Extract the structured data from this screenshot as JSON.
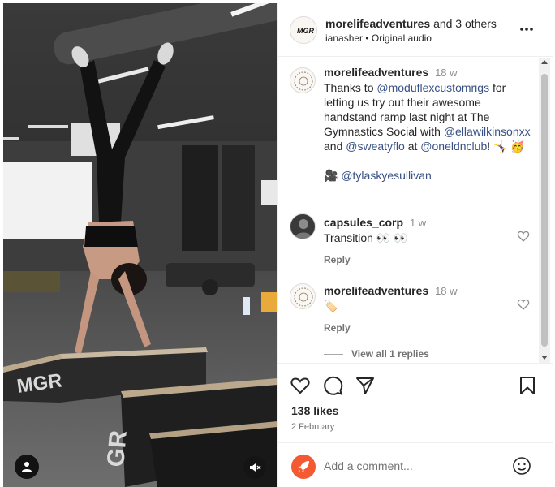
{
  "post": {
    "author": "morelifeadventures",
    "coauthors": "and 3 others",
    "audio_user": "ianasher",
    "audio_label": "Original audio"
  },
  "caption": {
    "user": "morelifeadventures",
    "time": "18 w",
    "text_1": "Thanks to ",
    "mention_1": "@moduflexcustomrigs",
    "text_2": " for letting us try out their awesome handstand ramp last night at The Gymnastics Social with ",
    "mention_2": "@ellawilkinsonxx",
    "text_3": " and ",
    "mention_3": "@sweatyflo",
    "text_4": " at ",
    "mention_4": "@oneldnclub",
    "text_5": "! 🤸‍♀️ 🥳",
    "tag_emoji": "🎥",
    "tag": "@tylaskyesullivan"
  },
  "comments": [
    {
      "user": "capsules_corp",
      "time": "1 w",
      "text": "Transition 👀 👀",
      "reply": "Reply"
    },
    {
      "user": "morelifeadventures",
      "time": "18 w",
      "text": "🏷️",
      "reply": "Reply"
    }
  ],
  "view_replies": "View all 1 replies",
  "likes": "138 likes",
  "date": "2 February",
  "add_comment_placeholder": "Add a comment...",
  "media_brand": "MGR",
  "colors": {
    "accent_orange": "#f35a32",
    "mention": "#385185",
    "muted": "#737373"
  }
}
